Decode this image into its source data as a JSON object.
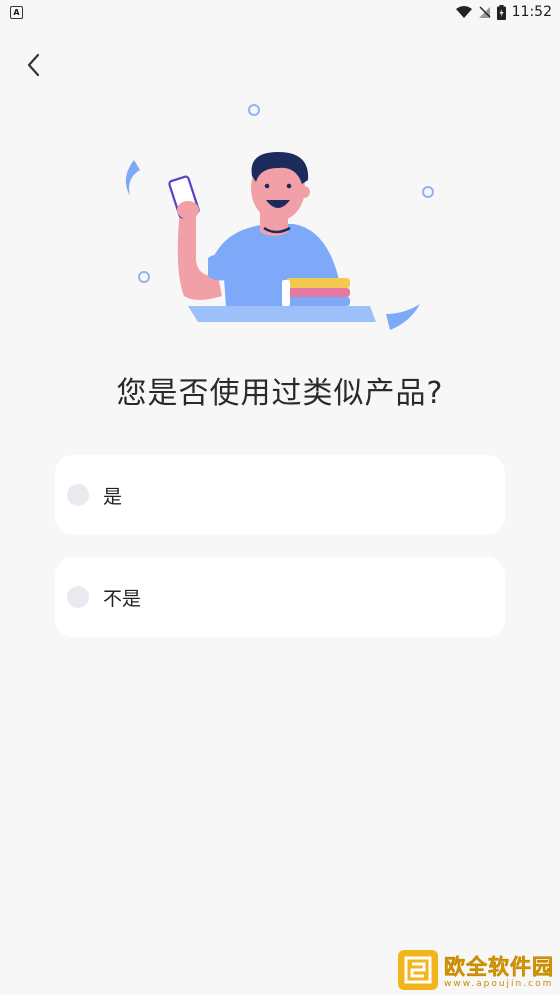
{
  "status_bar": {
    "app_icon": "A",
    "time": "11:52",
    "icons": [
      "wifi-icon",
      "signal-off-icon",
      "battery-charging-icon"
    ]
  },
  "header": {
    "back_icon": "chevron-left-icon"
  },
  "hero": {
    "illustration": "person-holding-phone-with-books"
  },
  "question": {
    "title": "您是否使用过类似产品?"
  },
  "options": [
    {
      "label": "是",
      "selected": false
    },
    {
      "label": "不是",
      "selected": false
    }
  ],
  "watermark": {
    "title": "欧全软件园",
    "subtitle": "www.apoujin.com"
  },
  "colors": {
    "background": "#f7f7f7",
    "card": "#ffffff",
    "radio": "#e9e9ef",
    "accent_blue": "#7ea8f8",
    "skin": "#f2a0a8",
    "watermark": "#f2b51c"
  }
}
